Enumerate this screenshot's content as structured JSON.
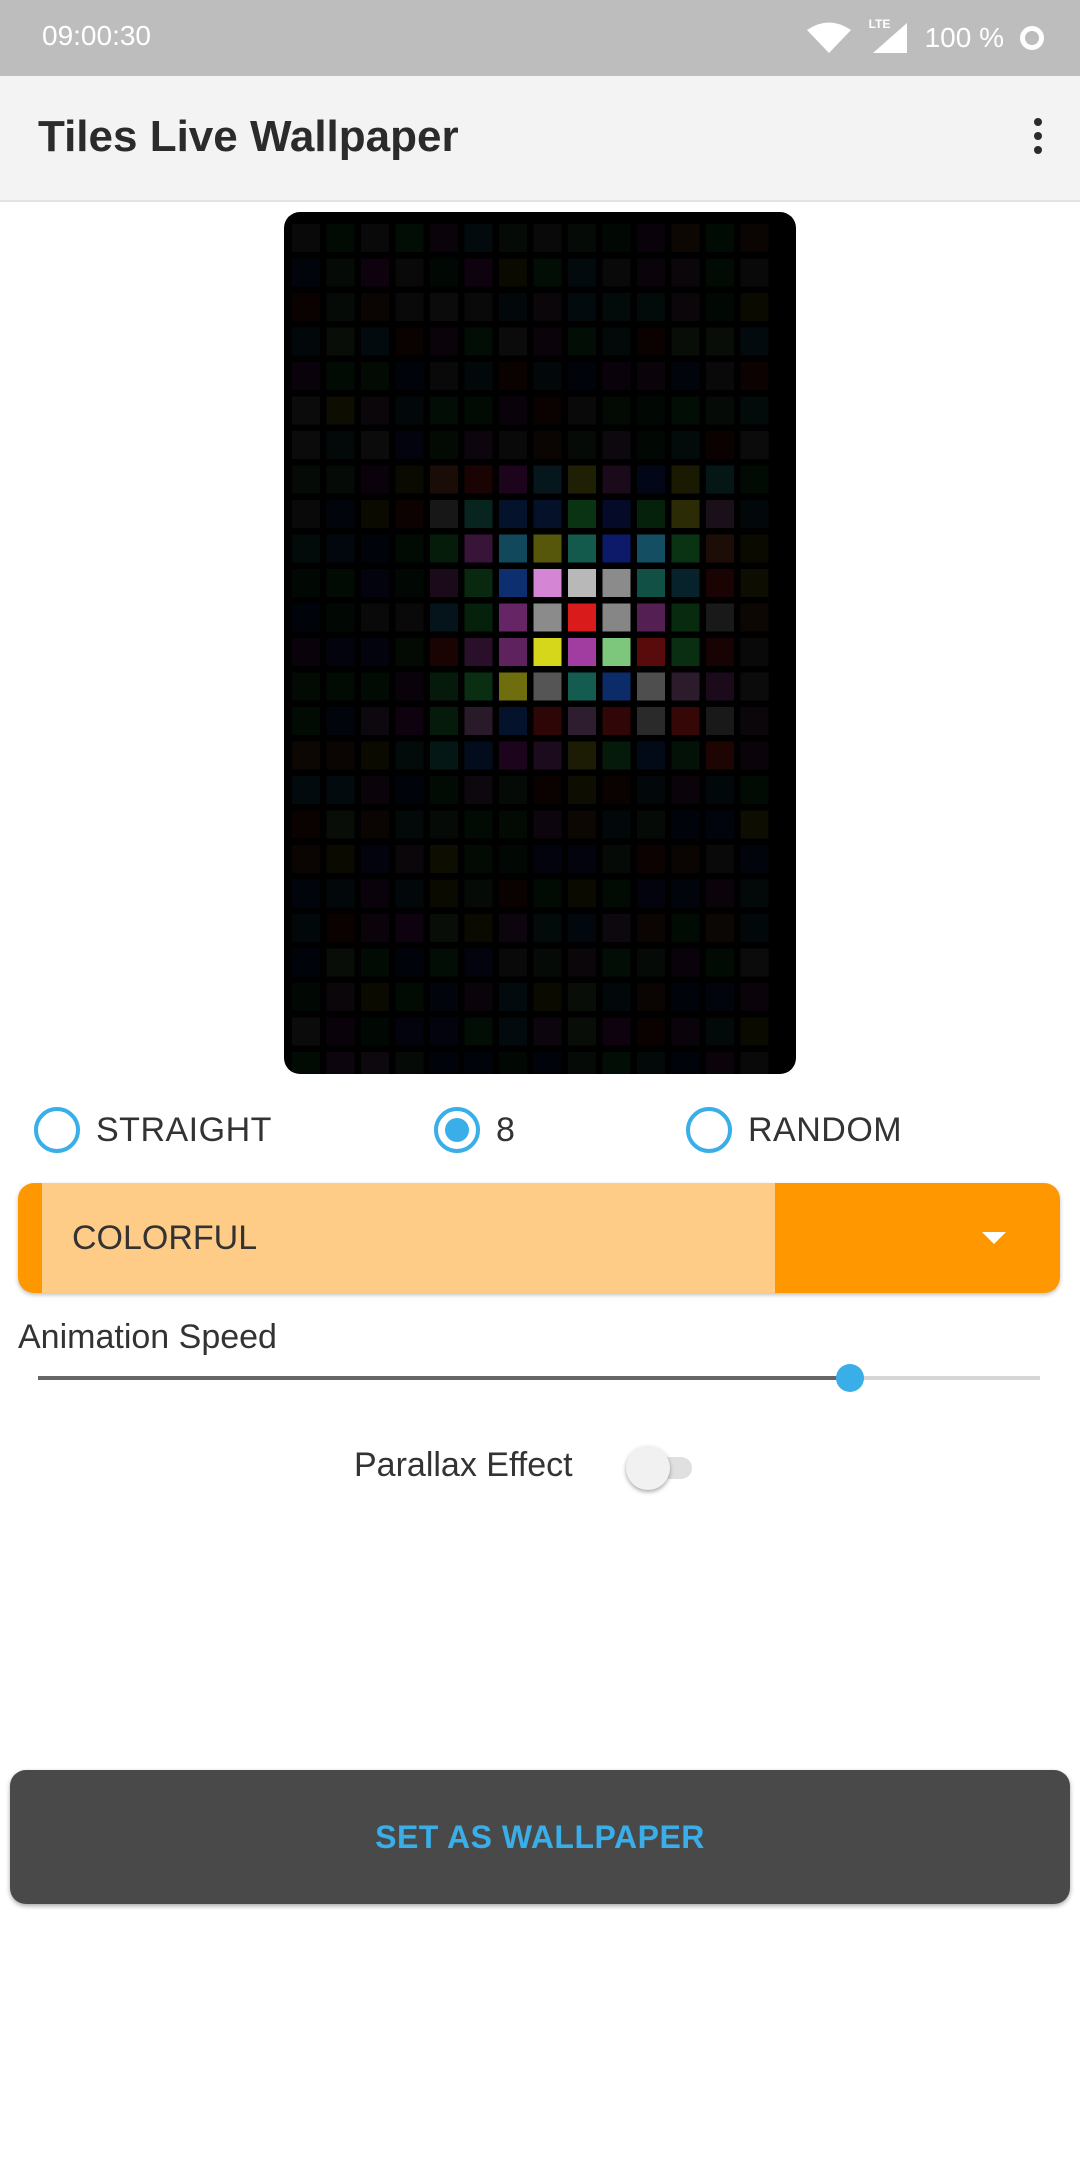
{
  "status_bar": {
    "time": "09:00:30",
    "battery": "100 %",
    "network": "LTE"
  },
  "app_bar": {
    "title": "Tiles Live Wallpaper"
  },
  "direction_options": [
    {
      "label": "STRAIGHT",
      "checked": false
    },
    {
      "label": "8",
      "checked": true
    },
    {
      "label": "RANDOM",
      "checked": false
    }
  ],
  "color_dropdown": {
    "selected": "COLORFUL"
  },
  "animation_speed": {
    "label": "Animation Speed",
    "value_fraction": 0.81
  },
  "parallax": {
    "label": "Parallax Effect",
    "enabled": false
  },
  "set_wallpaper_button": {
    "label": "SET AS WALLPAPER"
  },
  "colors": {
    "accent": "#3aaee8",
    "dropdown_bg": "#ff9800",
    "dropdown_field": "#ffcc88",
    "button_bg": "#494949"
  }
}
